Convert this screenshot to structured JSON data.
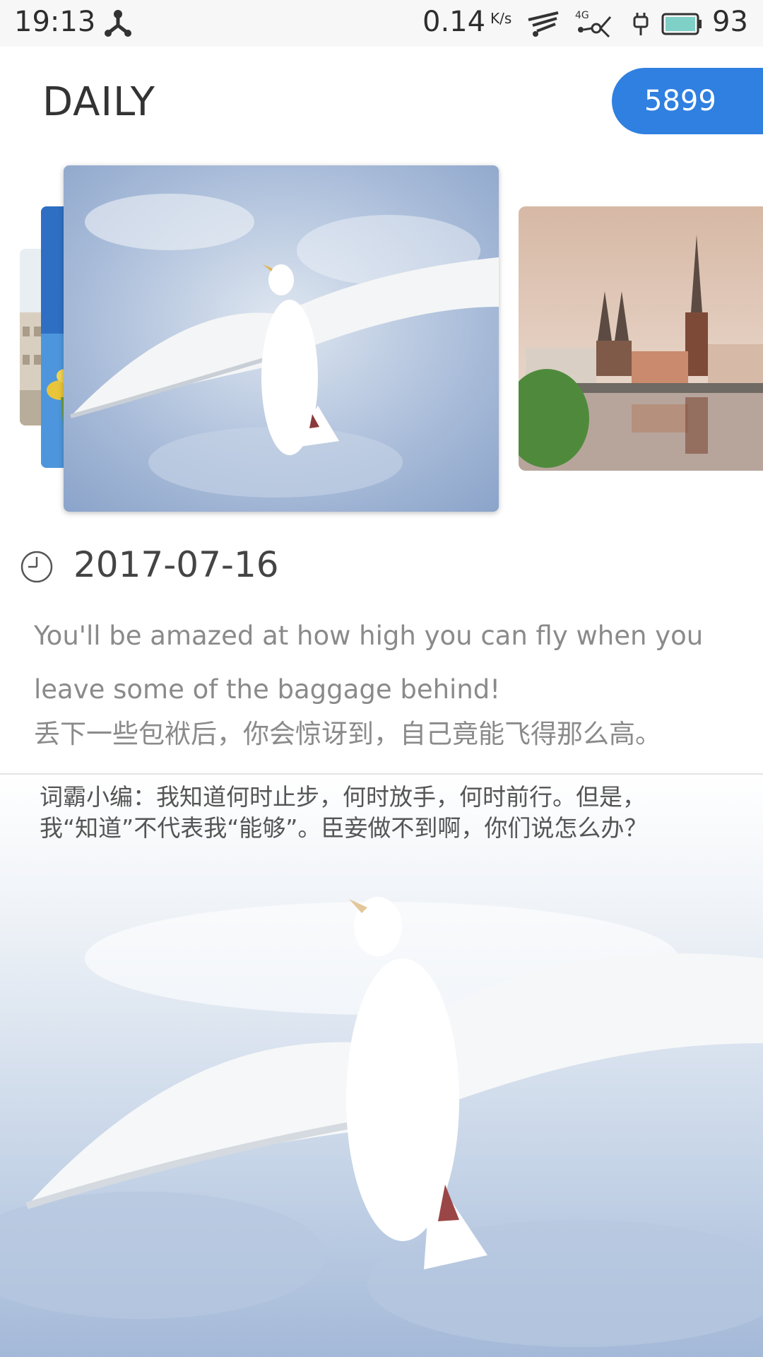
{
  "status_bar": {
    "time": "19:13",
    "speed_value": "0.14",
    "speed_unit": "K/s",
    "network": "4G",
    "battery_level": "93",
    "icons": [
      "usb-icon",
      "wifi-icon",
      "network-4g-icon",
      "charging-icon",
      "battery-icon"
    ]
  },
  "header": {
    "title": "DAILY",
    "count": "5899",
    "accent_color": "#2f80e0"
  },
  "carousel": {
    "cards": [
      {
        "subject": "building"
      },
      {
        "subject": "flowers-sky"
      },
      {
        "subject": "seagull-sky"
      },
      {
        "subject": "city-waterfront"
      }
    ]
  },
  "entry": {
    "date": "2017-07-16",
    "quote_en": "You'll be amazed at how high you can fly when you leave some of the baggage behind!",
    "quote_zh": "丢下一些包袱后，你会惊讶到，自己竟能飞得那么高。",
    "editor_note_line1": "词霸小编：我知道何时止步，何时放手，何时前行。但是，",
    "editor_note_line2": "我“知道”不代表我“能够”。臣妾做不到啊，你们说怎么办？"
  }
}
